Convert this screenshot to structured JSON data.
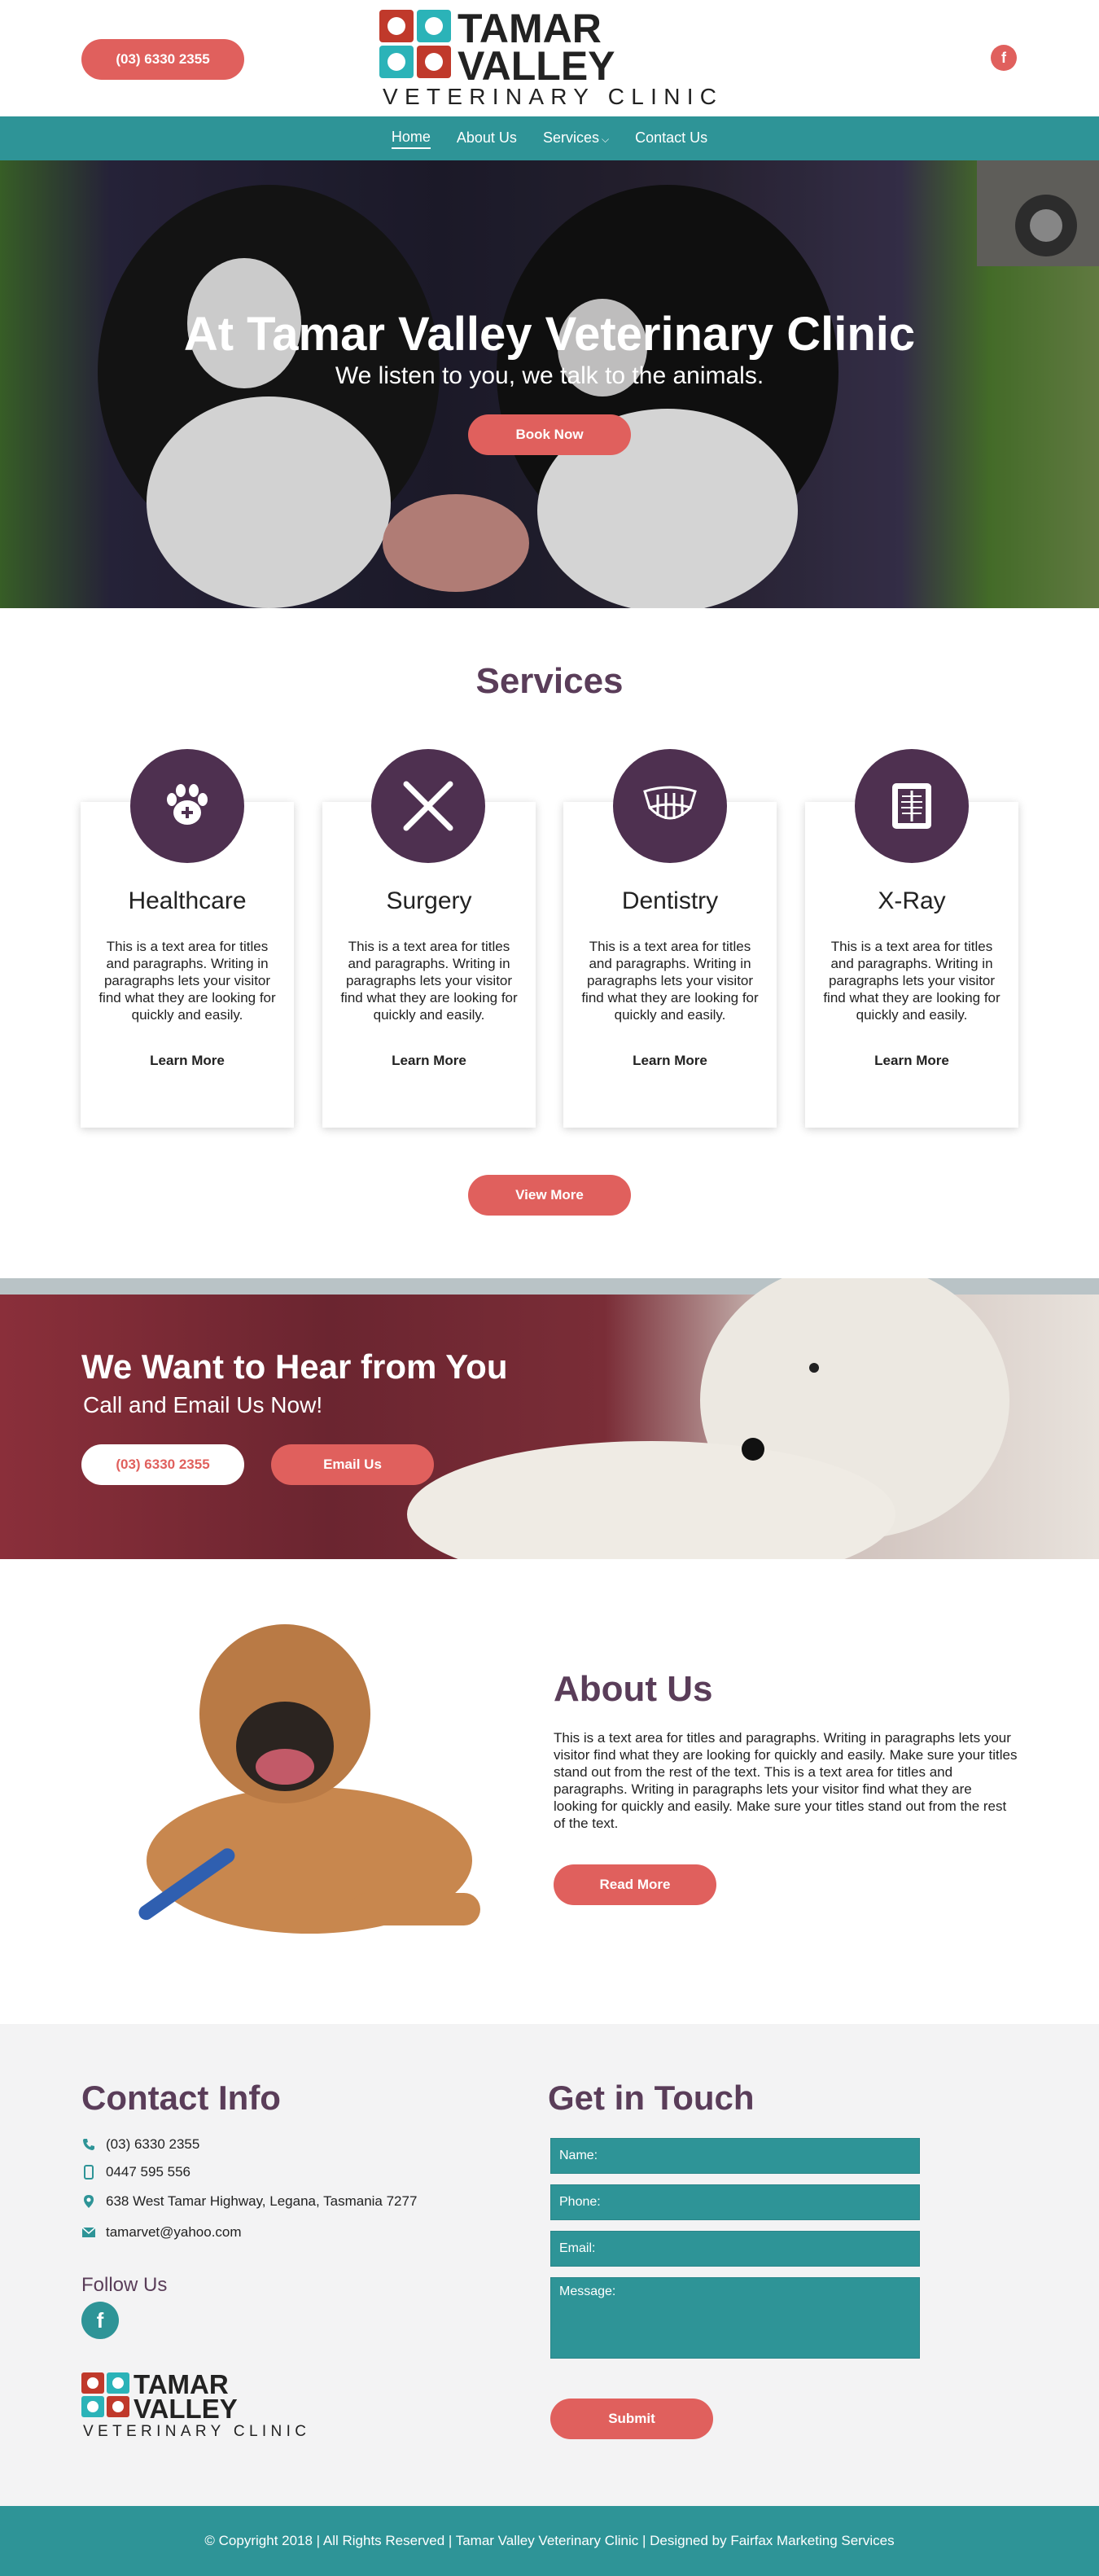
{
  "header": {
    "phone_label": "(03) 6330 2355",
    "logo": {
      "line1": "TAMAR",
      "line2": "VALLEY",
      "line3": "VETERINARY CLINIC"
    },
    "facebook_glyph": "f"
  },
  "nav": {
    "items": [
      {
        "label": "Home",
        "active": true
      },
      {
        "label": "About Us"
      },
      {
        "label": "Services"
      },
      {
        "label": "Contact Us"
      }
    ]
  },
  "hero": {
    "title": "At Tamar Valley Veterinary Clinic",
    "subtitle": "We listen to you, we talk to the animals.",
    "button": "Book Now"
  },
  "services": {
    "title": "Services",
    "cards": [
      {
        "title": "Healthcare",
        "icon": "paw-plus-icon",
        "text": "This is a text area for titles and paragraphs. Writing in paragraphs lets your visitor find what they are looking for quickly and easily.",
        "link": "Learn More"
      },
      {
        "title": "Surgery",
        "icon": "scalpel-cross-icon",
        "text": "This is a text area for titles and paragraphs. Writing in paragraphs lets your visitor find what they are looking for quickly and easily.",
        "link": "Learn More"
      },
      {
        "title": "Dentistry",
        "icon": "teeth-icon",
        "text": "This is a text area for titles and paragraphs. Writing in paragraphs lets your visitor find what they are looking for quickly and easily.",
        "link": "Learn More"
      },
      {
        "title": "X-Ray",
        "icon": "xray-icon",
        "text": "This is a text area for titles and paragraphs. Writing in paragraphs lets your visitor find what they are looking for quickly and easily.",
        "link": "Learn More"
      }
    ],
    "view_more": "View More"
  },
  "cta": {
    "title": "We Want to Hear from You",
    "subtitle": "Call and Email Us Now!",
    "phone_button": "(03) 6330 2355",
    "email_button": "Email Us"
  },
  "about": {
    "title": "About Us",
    "text": "This is a text area for titles and paragraphs. Writing in paragraphs lets your visitor find what they are looking for quickly and easily. Make sure your titles stand out from the rest of the text. This is a text area for titles and paragraphs. Writing in paragraphs lets your visitor find what they are looking for quickly and easily. Make sure your titles stand out from the rest of the text.",
    "button": "Read More"
  },
  "contact": {
    "title": "Contact Info",
    "phone": "(03) 6330 2355",
    "mobile": "0447 595 556",
    "address": "638 West Tamar Highway, Legana, Tasmania 7277",
    "email": "tamarvet@yahoo.com",
    "follow": "Follow Us",
    "facebook_glyph": "f",
    "logo": {
      "line1": "TAMAR",
      "line2": "VALLEY",
      "line3": "VETERINARY CLINIC"
    }
  },
  "form": {
    "title": "Get in Touch",
    "name_placeholder": "Name:",
    "phone_placeholder": "Phone:",
    "email_placeholder": "Email:",
    "message_placeholder": "Message:",
    "submit": "Submit"
  },
  "footer": {
    "text": "© Copyright 2018 | All Rights Reserved | Tamar Valley Veterinary Clinic | Designed by Fairfax Marketing Services"
  },
  "colors": {
    "teal": "#2e9497",
    "coral": "#e0605d",
    "plum": "#5a3d59",
    "logo_red": "#c0392b",
    "logo_teal": "#2bb3b8"
  }
}
